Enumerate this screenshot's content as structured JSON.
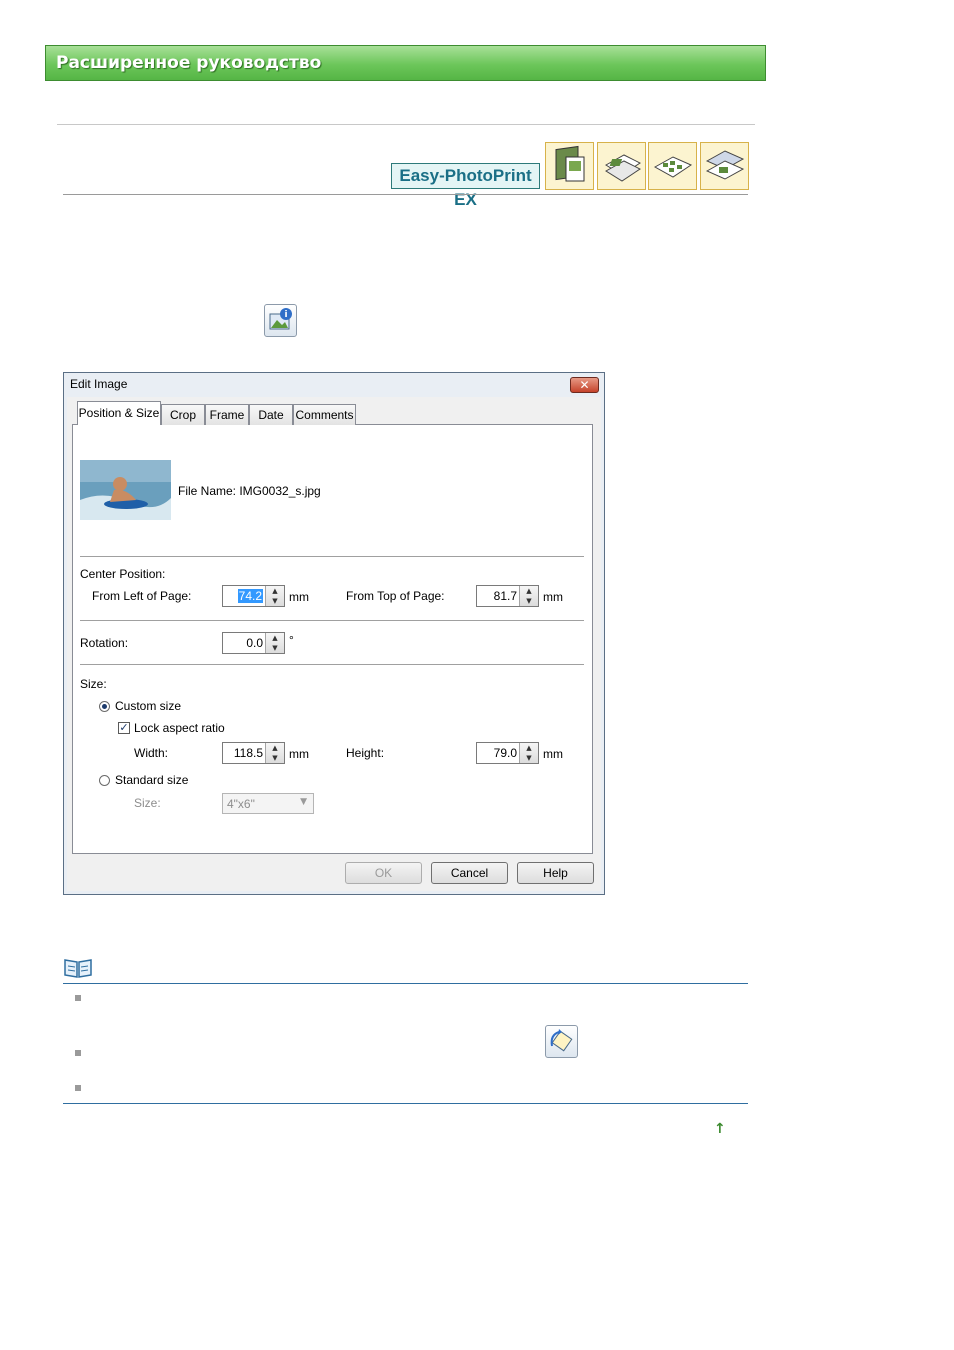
{
  "header": {
    "title": "Расширенное руководство"
  },
  "product": {
    "label": "Easy-PhotoPrint EX",
    "icons": [
      "album-icon",
      "calendar-icon",
      "stickers-icon",
      "layout-print-icon"
    ]
  },
  "toolbar_icons": [
    "image-info-icon",
    "image-rotate-icon"
  ],
  "dialog": {
    "title": "Edit Image",
    "close_symbol": "✕",
    "tabs": [
      "Position & Size",
      "Crop",
      "Frame",
      "Date",
      "Comments"
    ],
    "active_tab": "Position & Size",
    "file_name": "File Name: IMG0032_s.jpg",
    "center_position": {
      "label": "Center Position:",
      "left_label": "From Left of Page:",
      "left_value": "74.2",
      "left_unit": "mm",
      "top_label": "From Top of Page:",
      "top_value": "81.7",
      "top_unit": "mm"
    },
    "rotation": {
      "label": "Rotation:",
      "value": "0.0",
      "unit": "°"
    },
    "size": {
      "label": "Size:",
      "custom_label": "Custom size",
      "custom_selected": true,
      "lock_label": "Lock aspect ratio",
      "lock_checked": true,
      "width_label": "Width:",
      "width_value": "118.5",
      "width_unit": "mm",
      "height_label": "Height:",
      "height_value": "79.0",
      "height_unit": "mm",
      "standard_label": "Standard size",
      "standard_selected": false,
      "size_combo_label": "Size:",
      "size_combo_value": "4\"x6\""
    },
    "buttons": {
      "ok": "OK",
      "cancel": "Cancel",
      "help": "Help"
    }
  },
  "footer": {
    "top_arrow": "↑"
  },
  "colors": {
    "banner": "#6cc65a",
    "product_text": "#1a6f86",
    "note_rule": "#2f6ea0"
  }
}
